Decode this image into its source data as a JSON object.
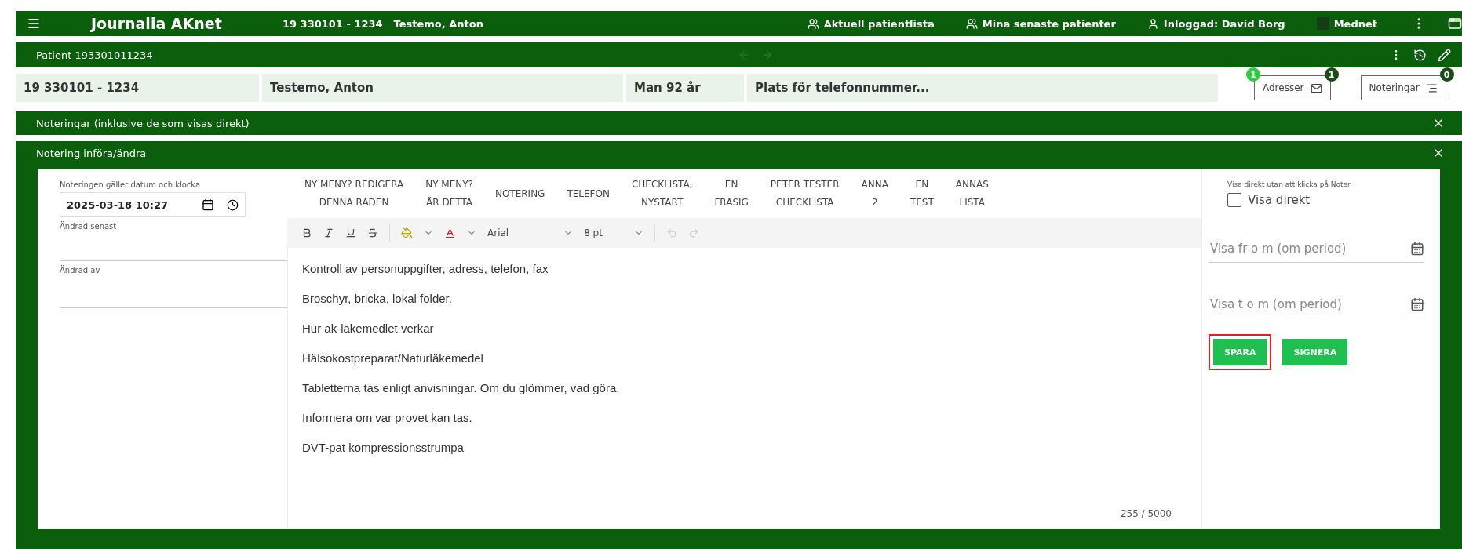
{
  "app_bar": {
    "title": "Journalia AKnet",
    "patient_id": "19 330101 - 1234",
    "patient_name": "Testemo, Anton",
    "links": [
      {
        "kind": "group",
        "label": "Aktuell patientlista"
      },
      {
        "kind": "group",
        "label": "Mina senaste patienter"
      },
      {
        "kind": "user",
        "label": "Inloggad: David Borg"
      },
      {
        "kind": "square",
        "label": "Mednet"
      }
    ]
  },
  "patient_bar": {
    "title": "Patient 193301011234",
    "nav_disabled": true
  },
  "info_row": {
    "cells": [
      "19 330101 - 1234",
      "Testemo, Anton",
      "Man 92 år",
      "Plats för telefonnummer..."
    ],
    "buttons": [
      {
        "label": "Adresser",
        "kind": "mail",
        "badges": [
          {
            "text": "1",
            "color": "#2ecc40"
          },
          {
            "text": "1",
            "color": "#1b4d1b"
          }
        ]
      },
      {
        "label": "Noteringar",
        "kind": "list",
        "badges": [
          {
            "text": "0",
            "color": "#1b4d1b"
          }
        ]
      }
    ]
  },
  "sections": [
    {
      "title": "Noteringar (inklusive de som visas direkt)"
    },
    {
      "title": "Notering införa/ändra"
    }
  ],
  "form": {
    "date_label": "Noteringen gäller datum och klocka",
    "date_value": "2025-03-18 10:27",
    "changed_label": "Ändrad senast",
    "changed_by_label": "Ändrad av",
    "menu": [
      [
        "NY MENY? REDIGERA",
        "DENNA RADEN"
      ],
      [
        "NY MENY?",
        "ÄR DETTA"
      ],
      [
        "NOTERING"
      ],
      [
        "TELEFON"
      ],
      [
        "CHECKLISTA,",
        "NYSTART"
      ],
      [
        "EN",
        "FRASIG"
      ],
      [
        "PETER TESTER",
        "CHECKLISTA"
      ],
      [
        "ANNA",
        "2"
      ],
      [
        "EN",
        "TEST"
      ],
      [
        "ANNAS",
        "LISTA"
      ]
    ],
    "toolbar": {
      "font": "Arial",
      "size": "8 pt",
      "undo_disabled": true
    },
    "lines": [
      "Kontroll av personuppgifter, adress, telefon, fax",
      "Broschyr, bricka, lokal folder.",
      "Hur ak-läkemedlet verkar",
      "Hälsokostpreparat/Naturläkemedel",
      "Tabletterna tas enligt anvisningar. Om du glömmer, vad göra.",
      "Informera om var provet kan tas.",
      "DVT-pat kompressionsstrumpa"
    ],
    "counter": "255 / 5000",
    "direct_hint": "Visa direkt utan att klicka på Noter.",
    "direct": {
      "label": "Visa direkt",
      "checked": false
    },
    "from_placeholder": "Visa fr o m (om period)",
    "to_placeholder": "Visa t o m (om period)",
    "actions": [
      {
        "label": "SPARA",
        "highlighted": true
      },
      {
        "label": "SIGNERA",
        "highlighted": false
      }
    ]
  }
}
